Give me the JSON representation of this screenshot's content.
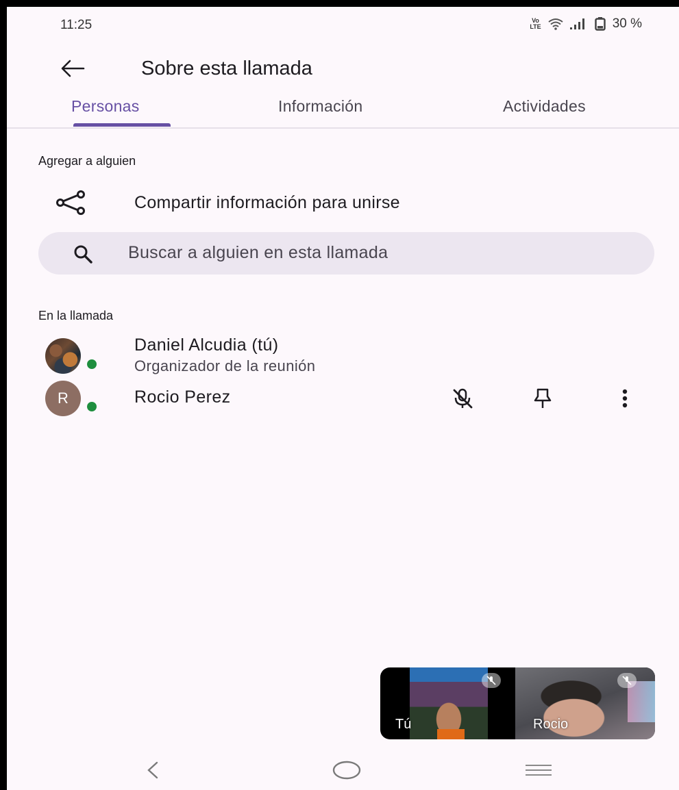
{
  "status_bar": {
    "time": "11:25",
    "network_badge_top": "Vo",
    "network_badge_bottom": "LTE",
    "battery": "30 %"
  },
  "app_bar": {
    "title": "Sobre esta llamada"
  },
  "tabs": [
    {
      "label": "Personas",
      "active": true
    },
    {
      "label": "Información",
      "active": false
    },
    {
      "label": "Actividades",
      "active": false
    }
  ],
  "add_section": {
    "label": "Agregar a alguien",
    "share_label": "Compartir información para unirse"
  },
  "search": {
    "placeholder": "Buscar a alguien en esta llamada"
  },
  "in_call": {
    "label": "En la llamada",
    "participants": [
      {
        "name": "Daniel Alcudia (tú)",
        "role": "Organizador de la reunión"
      },
      {
        "initial": "R",
        "name": "Rocio Perez"
      }
    ]
  },
  "video_tiles": [
    {
      "name": "Tú"
    },
    {
      "name": "Rocio"
    }
  ],
  "colors": {
    "accent": "#6750a4",
    "online": "#1e8e3e",
    "search_bg": "#ece6f0",
    "background": "#fdf8fc"
  },
  "icons": [
    "arrow-back-icon",
    "share-icon",
    "search-icon",
    "mic-off-icon",
    "pin-icon",
    "more-vert-icon",
    "nav-back-icon",
    "nav-home-icon",
    "nav-recents-icon"
  ]
}
